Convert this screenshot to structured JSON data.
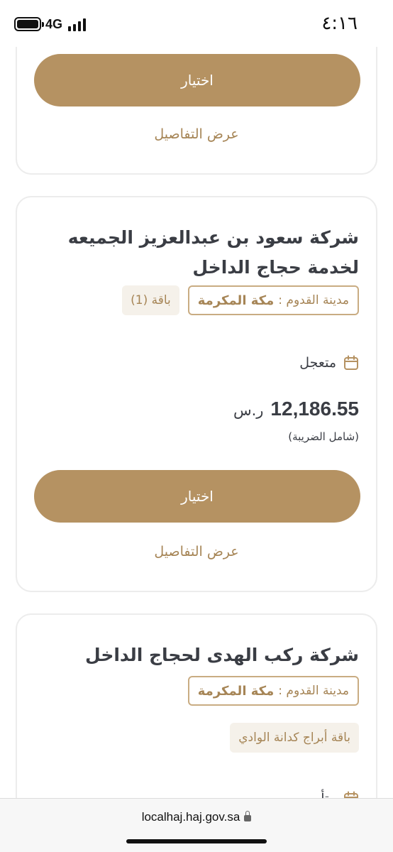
{
  "status_bar": {
    "network": "4G",
    "time": "٤:١٦"
  },
  "cards": [
    {
      "choose_label": "اختيار",
      "details_label": "عرض التفاصيل"
    },
    {
      "company_name_line1": "شركة سعود بن عبدالعزيز الجميعه",
      "company_name_line2": "لخدمة حجاج الداخل",
      "city_label": "مدينة القدوم :",
      "city_value": "مكة المكرمة",
      "package_label": "باقة (1)",
      "type_label": "متعجل",
      "type_icon": "calendar-icon",
      "price_amount": "12,186.55",
      "currency": "ر.س",
      "tax_note": "(شامل الضريبة)",
      "choose_label": "اختيار",
      "details_label": "عرض التفاصيل"
    },
    {
      "company_name": "شركة ركب الهدى لحجاج الداخل",
      "city_label": "مدينة القدوم :",
      "city_value": "مكة المكرمة",
      "package_label": "باقة أبراج كدانة الوادي",
      "type_label": "متأ",
      "type_icon": "calendar-icon"
    }
  ],
  "url_bar": {
    "url": "localhaj.haj.gov.sa",
    "lock_icon": "lock-icon"
  },
  "colors": {
    "accent": "#b59262",
    "accent_text": "#a68556",
    "tag_border": "#c9ac82",
    "card_border": "#ececec"
  }
}
